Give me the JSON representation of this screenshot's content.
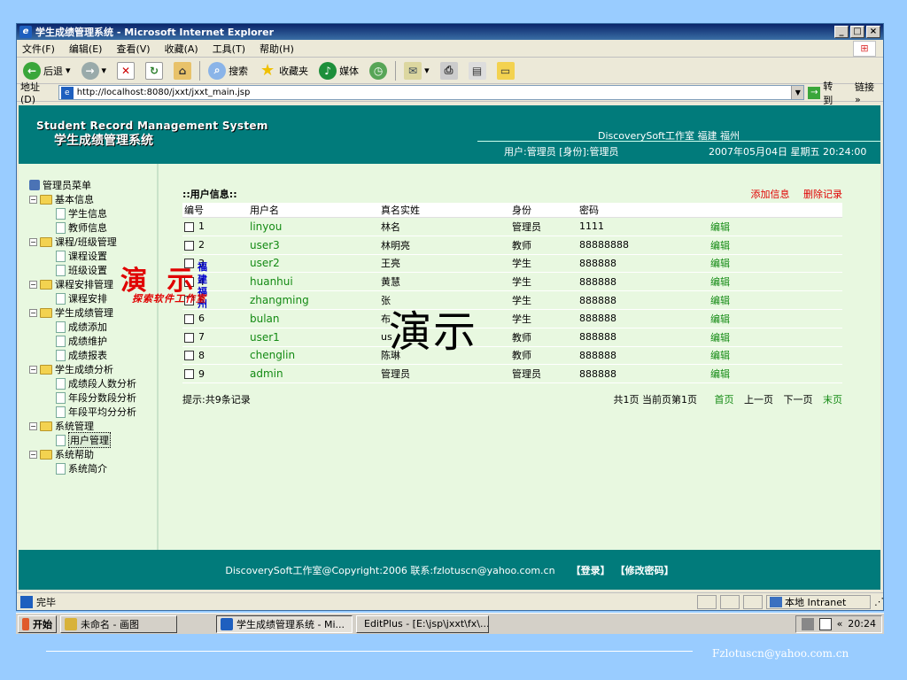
{
  "window": {
    "title": "学生成绩管理系统 - Microsoft Internet Explorer",
    "controls": [
      "_",
      "□",
      "×"
    ]
  },
  "menu": [
    "文件(F)",
    "编辑(E)",
    "查看(V)",
    "收藏(A)",
    "工具(T)",
    "帮助(H)"
  ],
  "toolbar": {
    "back": "后退",
    "search": "搜索",
    "favorites": "收藏夹",
    "media": "媒体"
  },
  "address": {
    "label": "地址(D)",
    "url": "http://localhost:8080/jxxt/jxxt_main.jsp",
    "go": "转到",
    "links": "链接 »"
  },
  "header": {
    "en_title": "Student Record Management System",
    "cn_title": "学生成绩管理系统",
    "studio": "DiscoverySoft工作室 福建 福州",
    "user": "用户:管理员 [身份]:管理员",
    "datetime": "2007年05月04日 星期五 20:24:00"
  },
  "sidebar": {
    "root": "管理员菜单",
    "groups": [
      {
        "label": "基本信息",
        "items": [
          "学生信息",
          "教师信息"
        ]
      },
      {
        "label": "课程/班级管理",
        "items": [
          "课程设置",
          "班级设置"
        ]
      },
      {
        "label": "课程安排管理",
        "items": [
          "课程安排"
        ]
      },
      {
        "label": "学生成绩管理",
        "items": [
          "成绩添加",
          "成绩维护",
          "成绩报表"
        ]
      },
      {
        "label": "学生成绩分析",
        "items": [
          "成绩段人数分析",
          "年段分数段分析",
          "年段平均分分析"
        ]
      },
      {
        "label": "系统管理",
        "items": [
          "用户管理"
        ]
      },
      {
        "label": "系统帮助",
        "items": [
          "系统简介"
        ]
      }
    ]
  },
  "watermarks": {
    "demo_small": "演 示",
    "location": "福建福州",
    "studio": "探索软件工作室",
    "demo_large": "演示"
  },
  "main": {
    "section_title": "::用户信息::",
    "add": "添加信息",
    "delete": "删除记录",
    "columns": [
      "编号",
      "用户名",
      "真名实姓",
      "身份",
      "密码",
      ""
    ],
    "rows": [
      {
        "id": "1",
        "username": "linyou",
        "realname": "林名",
        "role": "管理员",
        "password": "1111",
        "action": "编辑"
      },
      {
        "id": "2",
        "username": "user3",
        "realname": "林明亮",
        "role": "教师",
        "password": "88888888",
        "action": "编辑"
      },
      {
        "id": "3",
        "username": "user2",
        "realname": "王亮",
        "role": "学生",
        "password": "888888",
        "action": "编辑"
      },
      {
        "id": "4",
        "username": "huanhui",
        "realname": "黄慧",
        "role": "学生",
        "password": "888888",
        "action": "编辑"
      },
      {
        "id": "5",
        "username": "zhangming",
        "realname": "张",
        "role": "学生",
        "password": "888888",
        "action": "编辑"
      },
      {
        "id": "6",
        "username": "bulan",
        "realname": "布",
        "role": "学生",
        "password": "888888",
        "action": "编辑"
      },
      {
        "id": "7",
        "username": "user1",
        "realname": "us",
        "role": "教师",
        "password": "888888",
        "action": "编辑"
      },
      {
        "id": "8",
        "username": "chenglin",
        "realname": "陈琳",
        "role": "教师",
        "password": "888888",
        "action": "编辑"
      },
      {
        "id": "9",
        "username": "admin",
        "realname": "管理员",
        "role": "管理员",
        "password": "888888",
        "action": "编辑"
      }
    ],
    "hint": "提示:共9条记录",
    "pager": {
      "info": "共1页 当前页第1页",
      "first": "首页",
      "prev": "上一页",
      "next": "下一页",
      "last": "末页"
    }
  },
  "footer": {
    "copyright": "DiscoverySoft工作室@Copyright:2006 联系:fzlotuscn@yahoo.com.cn",
    "login": "【登录】",
    "change_pw": "【修改密码】"
  },
  "status": {
    "text": "完毕",
    "zone": "本地 Intranet"
  },
  "taskbar": {
    "start": "开始",
    "tasks": [
      "未命名 - 画图",
      "学生成绩管理系统 - Mi...",
      "EditPlus - [E:\\jsp\\jxxt\\fx\\..."
    ],
    "clock": "20:24",
    "tray_arrow": "«"
  },
  "slide": {
    "email": "Fzlotuscn@yahoo.com.cn"
  }
}
